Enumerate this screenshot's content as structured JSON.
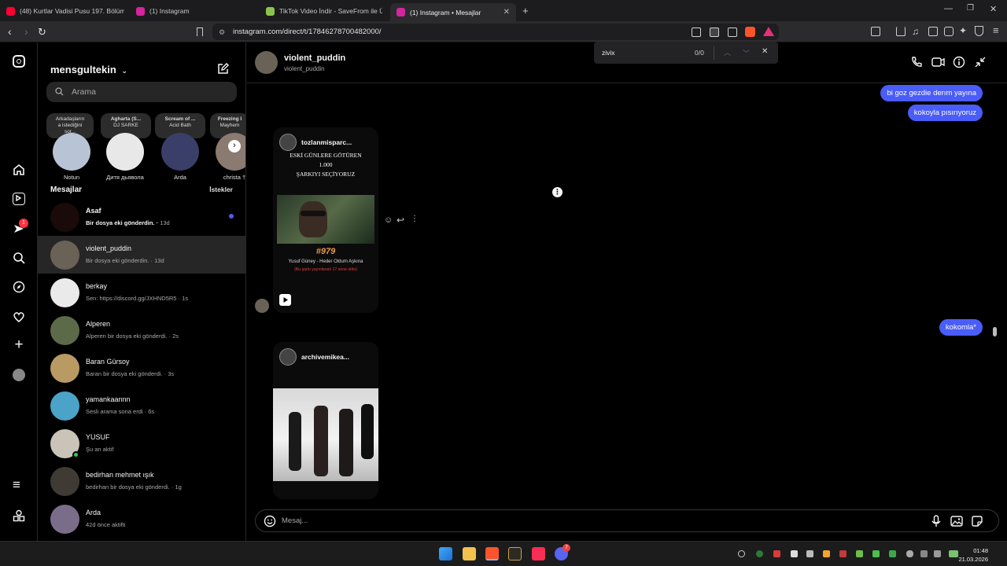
{
  "browser": {
    "tabs": [
      {
        "label": "(48) Kurtlar Vadisi Pusu 197. Bölüm -",
        "icon": "youtube-icon",
        "color": "#ff0033"
      },
      {
        "label": "(1) Instagram",
        "icon": "instagram-icon",
        "color": "#d6249f"
      },
      {
        "label": "TikTok Video İndir - SaveFrom ile Ücr",
        "icon": "download-icon",
        "color": "#8bc34a"
      },
      {
        "label": "(1) Instagram • Mesajlar",
        "icon": "instagram-icon",
        "color": "#d6249f",
        "active": true
      }
    ],
    "url": "instagram.com/direct/t/17846278700482000/"
  },
  "find_bar": {
    "query": "zivix",
    "count": "0/0"
  },
  "inbox": {
    "username": "mensgultekin",
    "search_placeholder": "Arama",
    "notes": [
      {
        "line1": "Arkadaşların",
        "line2": "a istediğini",
        "line3": "sor..."
      },
      {
        "line1": "Agharta (S...",
        "line2": "DJ SARKE"
      },
      {
        "line1": "Scream of ...",
        "line2": "Acid Bath"
      },
      {
        "line1": "Freezing I",
        "line2": "Mayhem"
      }
    ],
    "stories": [
      {
        "name": "Notun"
      },
      {
        "name": "Дитя дьявола"
      },
      {
        "name": "Arda"
      },
      {
        "name": "christa †"
      }
    ],
    "section_title": "Mesajlar",
    "requests_label": "İstekler",
    "threads": [
      {
        "name": "Asaf",
        "preview": "Bir dosya eki gönderdin.",
        "time": "13d",
        "unread": true
      },
      {
        "name": "violent_puddin",
        "preview": "Bir dosya eki gönderdin.",
        "time": "13d",
        "selected": true
      },
      {
        "name": "berkay",
        "preview": "Sen: https://discord.gg/JXHND5R5",
        "time": "1s"
      },
      {
        "name": "Alperen",
        "preview": "Alperen bir dosya eki gönderdi.",
        "time": "2s"
      },
      {
        "name": "Baran Gürsoy",
        "preview": "Baran bir dosya eki gönderdi.",
        "time": "3s"
      },
      {
        "name": "yamankaannn",
        "preview": "Sesli arama sona erdi",
        "time": "6s"
      },
      {
        "name": "YUSUF",
        "preview": "Şu an aktif",
        "time": "",
        "online": true
      },
      {
        "name": "bedirhan mehmet ışık",
        "preview": "bedirhan bir dosya eki gönderdi.",
        "time": "1g"
      },
      {
        "name": "Arda",
        "preview": "42d önce aktifti",
        "time": ""
      }
    ]
  },
  "chat": {
    "name": "violent_puddin",
    "username": "violent_puddin",
    "messages_out": [
      "bi goz gezdie derım yayına",
      "kokoyla pısırıyoruz",
      "kokomla*"
    ],
    "card1": {
      "account": "tozlanmisparc...",
      "headline1": "ESKİ GÜNLERE GÖTÜREN",
      "headline2": "1.000",
      "headline3": "ŞARKIYI SEÇİYORUZ",
      "number": "#979",
      "song": "Yusuf Güney - Heder Oldum Aşkına",
      "note": "(Bu şarkı yayınlanalı 17 sene oldu)"
    },
    "card2": {
      "account": "archivemikea..."
    },
    "composer_placeholder": "Mesaj..."
  },
  "taskbar": {
    "time": "01:48",
    "date": "21.03.2026",
    "discord_badge": "7"
  },
  "rail": {
    "notification_badge": "1"
  },
  "colors": {
    "accent": "#4a5df9",
    "background": "#000000",
    "surface": "#262626"
  }
}
